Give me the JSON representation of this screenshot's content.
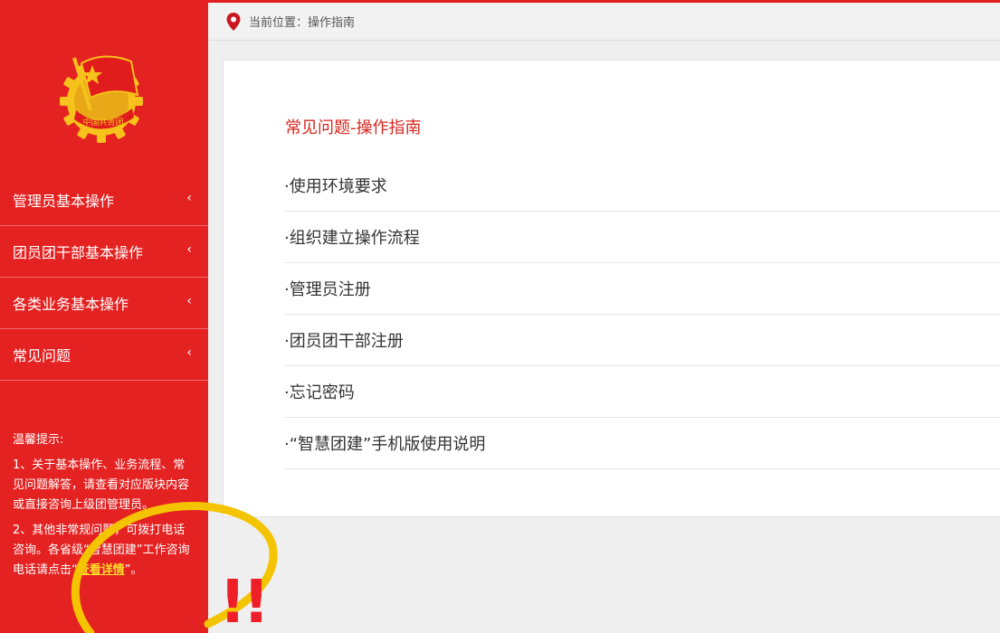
{
  "breadcrumb": {
    "prefix": "当前位置：",
    "current": "操作指南"
  },
  "sidebar": {
    "logo_text": "中国共青团",
    "items": [
      {
        "label": "管理员基本操作"
      },
      {
        "label": "团员团干部基本操作"
      },
      {
        "label": "各类业务基本操作"
      },
      {
        "label": "常见问题"
      }
    ],
    "chevron": "‹",
    "tips": {
      "title": "温馨提示:",
      "tip1": "1、关于基本操作、业务流程、常见问题解答，请查看对应版块内容或直接咨询上级团管理员。",
      "tip2_before": "2、其他非常规问题，可拨打电话咨询。各省级“智慧团建”工作咨询电话请点击“",
      "tip2_link": "查看详情",
      "tip2_after": "”。"
    }
  },
  "main": {
    "title": "常见问题-操作指南",
    "items": [
      {
        "label": "·使用环境要求"
      },
      {
        "label": "·组织建立操作流程"
      },
      {
        "label": "·管理员注册"
      },
      {
        "label": "·团员团干部注册"
      },
      {
        "label": "·忘记密码"
      },
      {
        "label": "·“智慧团建”手机版使用说明"
      }
    ]
  },
  "annotation": {
    "marks": "!!"
  },
  "colors": {
    "brand_red": "#e52222",
    "title_red": "#d7261e",
    "highlight_yellow": "#f5c400"
  }
}
